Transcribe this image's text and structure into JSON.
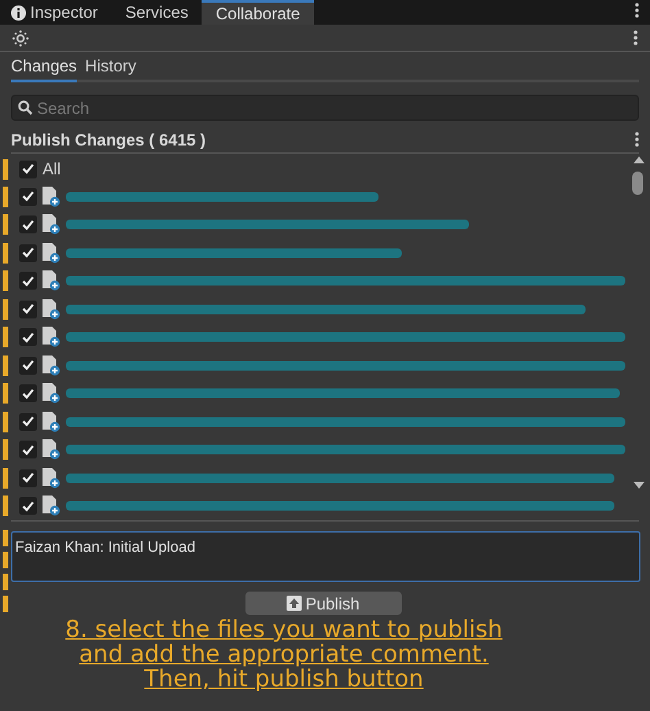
{
  "window_tabs": [
    {
      "label": "Inspector",
      "selected": false,
      "kind": "info"
    },
    {
      "label": "Services",
      "selected": false,
      "kind": "plain"
    },
    {
      "label": "Collaborate",
      "selected": true,
      "kind": "plain"
    }
  ],
  "view_tabs": [
    {
      "label": "Changes",
      "selected": true
    },
    {
      "label": "History",
      "selected": false
    }
  ],
  "search": {
    "placeholder": "Search"
  },
  "publish_header": "Publish Changes ( 6415 )",
  "all_row": {
    "label": "All",
    "checked": true
  },
  "files": [
    {
      "checked": true
    },
    {
      "checked": true
    },
    {
      "checked": true
    },
    {
      "checked": true
    },
    {
      "checked": true
    },
    {
      "checked": true
    },
    {
      "checked": true
    },
    {
      "checked": true
    },
    {
      "checked": true
    },
    {
      "checked": true
    },
    {
      "checked": true
    },
    {
      "checked": true
    }
  ],
  "comment": {
    "value": "Faizan Khan: Initial Upload"
  },
  "publish_button": "Publish",
  "caption": "8. select the files you want to publish and add the appropriate comment. Then, hit publish button"
}
